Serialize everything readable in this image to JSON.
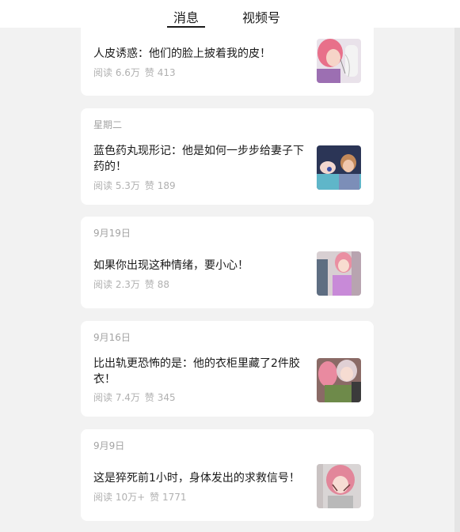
{
  "header": {
    "tabs": [
      {
        "label": "消息"
      },
      {
        "label": "视频号"
      }
    ]
  },
  "articles": [
    {
      "date": "",
      "title": "人皮诱惑：他们的脸上披着我的皮！",
      "reads": "阅读 6.6万",
      "likes": "赞 413"
    },
    {
      "date": "星期二",
      "title": "蓝色药丸现形记：他是如何一步步给妻子下药的！",
      "reads": "阅读 5.3万",
      "likes": "赞 189"
    },
    {
      "date": "9月19日",
      "title": "如果你出现这种情绪，要小心！",
      "reads": "阅读 2.3万",
      "likes": "赞 88"
    },
    {
      "date": "9月16日",
      "title": "比出轨更恐怖的是：他的衣柜里藏了2件胶衣！",
      "reads": "阅读 7.4万",
      "likes": "赞 345"
    },
    {
      "date": "9月9日",
      "title": "这是猝死前1小时，身体发出的求救信号！",
      "reads": "阅读 10万+",
      "likes": "赞 1771"
    }
  ]
}
